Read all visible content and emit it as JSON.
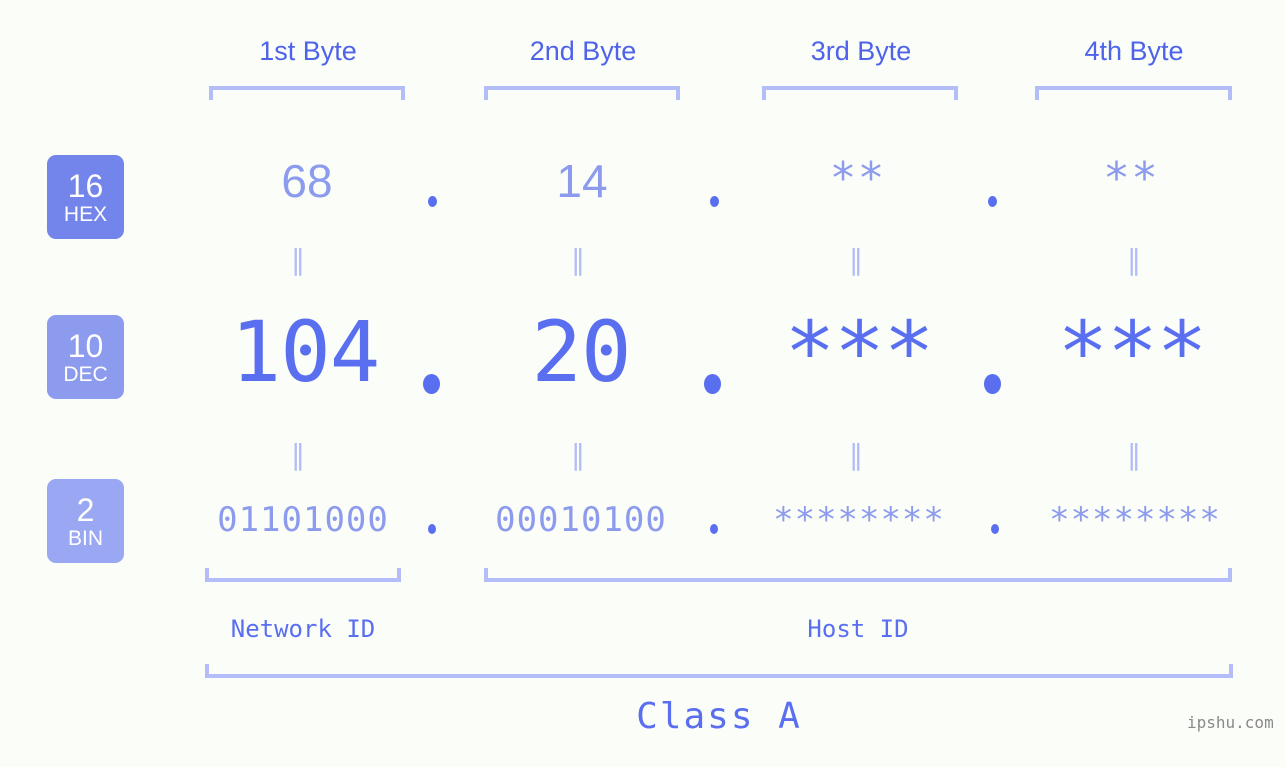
{
  "meta": {
    "background_color": "#fbfdf8",
    "accent_strong": "#5a6ff0",
    "accent_mid": "#8c9bee",
    "accent_light": "#b3bdf7",
    "header_color": "#4e63ea",
    "watermark_color": "#8a8a8a"
  },
  "headers": {
    "byte1": "1st Byte",
    "byte2": "2nd Byte",
    "byte3": "3rd Byte",
    "byte4": "4th Byte"
  },
  "bases": [
    {
      "id": "hex",
      "number": "16",
      "label": "HEX",
      "color": "#7385ea"
    },
    {
      "id": "dec",
      "number": "10",
      "label": "DEC",
      "color": "#8c9bee"
    },
    {
      "id": "bin",
      "number": "2",
      "label": "BIN",
      "color": "#9aa8f3"
    }
  ],
  "rows": {
    "hex": {
      "base_number": "16",
      "base_label": "HEX",
      "values": [
        "68",
        "14",
        "**",
        "**"
      ],
      "separator": "."
    },
    "dec": {
      "base_number": "10",
      "base_label": "DEC",
      "values": [
        "104",
        "20",
        "***",
        "***"
      ],
      "separator": "."
    },
    "bin": {
      "base_number": "2",
      "base_label": "BIN",
      "values": [
        "01101000",
        "00010100",
        "********",
        "********"
      ],
      "separator": "."
    }
  },
  "connectors": {
    "glyph": "‖",
    "count_per_row_gap": 4
  },
  "sections": {
    "network_id": "Network ID",
    "host_id": "Host ID",
    "class": "Class A"
  },
  "watermark": "ipshu.com"
}
